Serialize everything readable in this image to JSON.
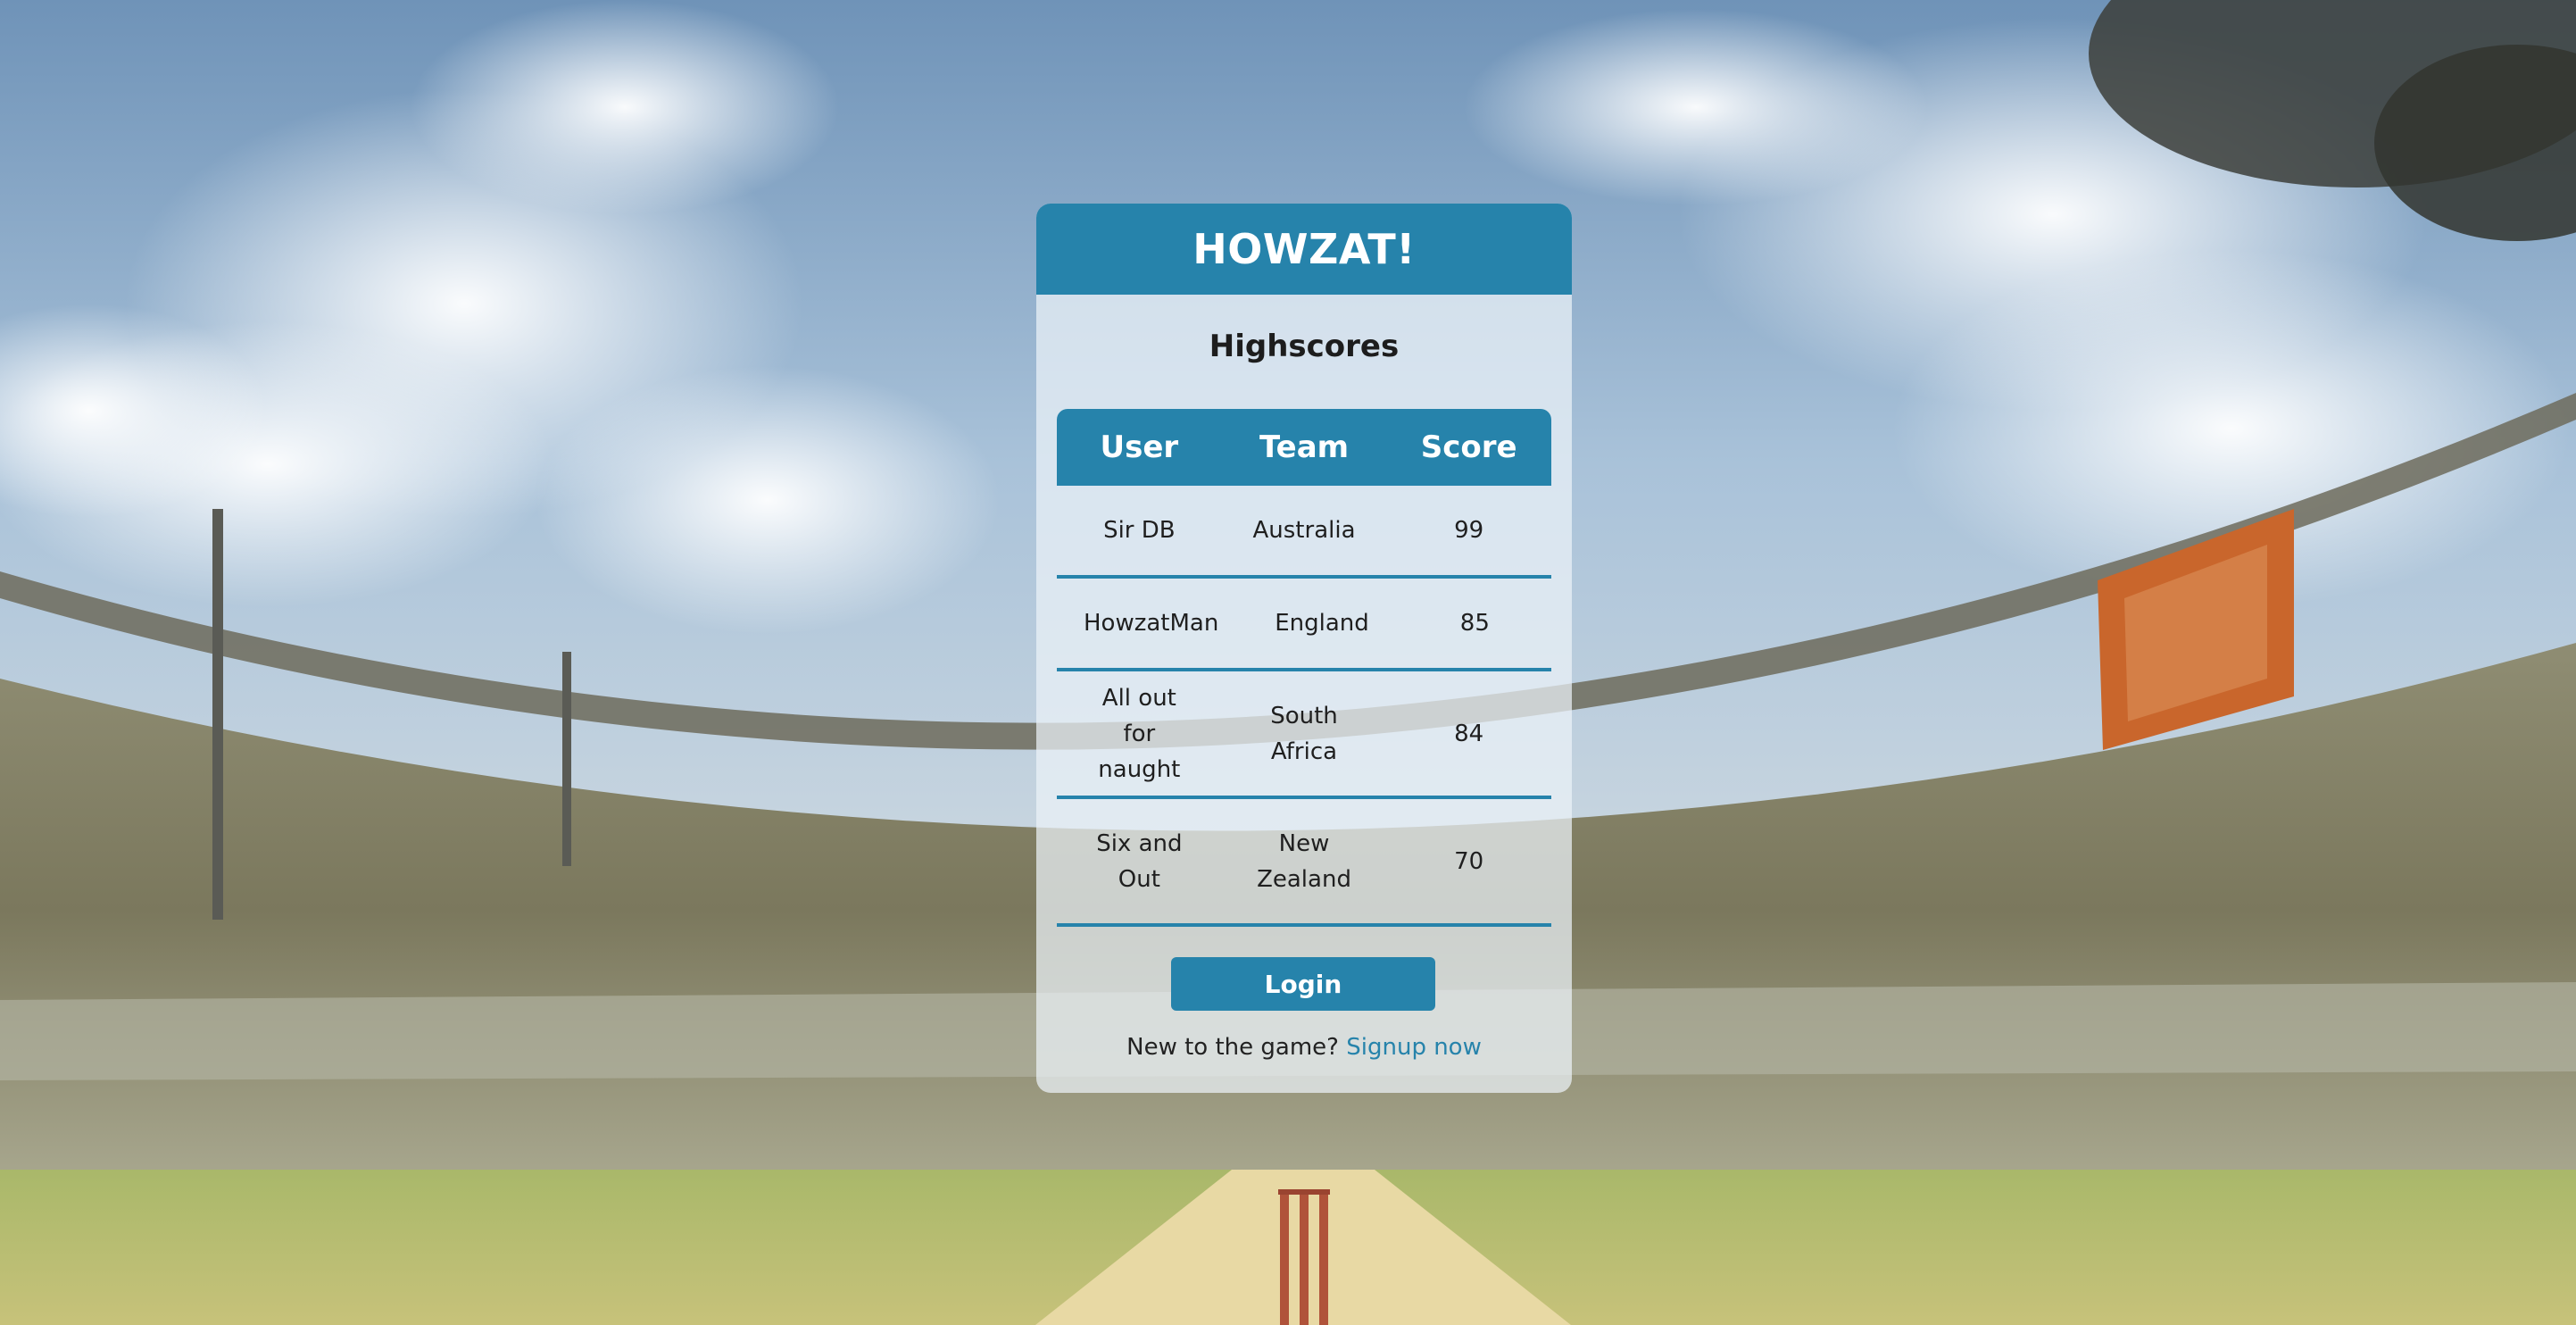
{
  "app": {
    "title": "HOWZAT!"
  },
  "highscores": {
    "heading": "Highscores",
    "columns": [
      "User",
      "Team",
      "Score"
    ],
    "rows": [
      {
        "user": "Sir DB",
        "team": "Australia",
        "score": "99"
      },
      {
        "user": "HowzatMan",
        "team": "England",
        "score": "85"
      },
      {
        "user": "All out for naught",
        "team": "South Africa",
        "score": "84"
      },
      {
        "user": "Six and Out",
        "team": "New Zealand",
        "score": "70"
      }
    ]
  },
  "auth": {
    "login_label": "Login",
    "signup_prompt": "New to the game?",
    "signup_link": "Signup now"
  },
  "colors": {
    "accent": "#2683ab",
    "card_bg": "rgba(236,242,248,0.72)"
  }
}
